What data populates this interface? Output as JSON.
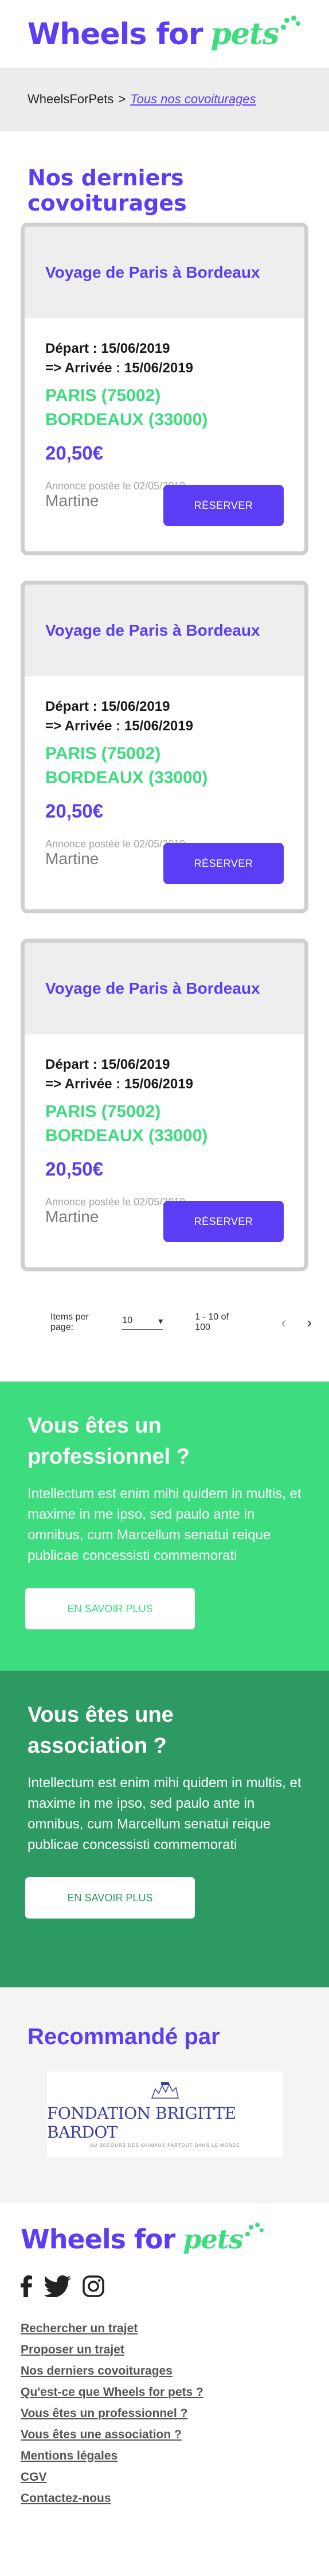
{
  "brand": {
    "name_part1": "Wheels for",
    "name_part2": "pets"
  },
  "breadcrumb": {
    "home": "WheelsForPets",
    "separator": ">",
    "current": "Tous nos covoiturages"
  },
  "page_title": "Nos derniers covoiturages",
  "trips": [
    {
      "title": "Voyage de Paris à Bordeaux",
      "departure": "Départ : 15/06/2019",
      "arrival": "=> Arrivée : 15/06/2019",
      "from": "PARIS (75002)",
      "to": "BORDEAUX (33000)",
      "price": "20,50€",
      "posted": "Annonce postée le 02/05/2019",
      "author": "Martine",
      "button": "RÉSERVER"
    },
    {
      "title": "Voyage de Paris à Bordeaux",
      "departure": "Départ : 15/06/2019",
      "arrival": "=> Arrivée : 15/06/2019",
      "from": "PARIS (75002)",
      "to": "BORDEAUX (33000)",
      "price": "20,50€",
      "posted": "Annonce postée le 02/05/2019",
      "author": "Martine",
      "button": "RÉSERVER"
    },
    {
      "title": "Voyage de Paris à Bordeaux",
      "departure": "Départ : 15/06/2019",
      "arrival": "=> Arrivée : 15/06/2019",
      "from": "PARIS (75002)",
      "to": "BORDEAUX (33000)",
      "price": "20,50€",
      "posted": "Annonce postée le 02/05/2019",
      "author": "Martine",
      "button": "RÉSERVER"
    }
  ],
  "pagination": {
    "items_per_page_label": "Items per page:",
    "items_per_page_value": "10",
    "range": "1 - 10 of 100",
    "prev_icon": "chevron-left",
    "next_icon": "chevron-right"
  },
  "promo_pro": {
    "title": "Vous êtes un professionnel ?",
    "text": "Intellectum est enim mihi quidem in multis, et maxime in me ipso, sed paulo ante in omnibus, cum Marcellum senatui reique publicae concessisti commemorati",
    "button": "EN SAVOIR PLUS"
  },
  "promo_asso": {
    "title": "Vous êtes une association ?",
    "text": "Intellectum est enim mihi quidem in multis, et maxime in me ipso, sed paulo ante in omnibus, cum Marcellum senatui reique publicae concessisti commemorati",
    "button": "EN SAVOIR PLUS"
  },
  "recommended": {
    "title": "Recommandé par",
    "partner_name": "FONDATION BRIGITTE BARDOT",
    "partner_tagline": "AU SECOURS DES ANIMAUX PARTOUT DANS LE MONDE"
  },
  "footer": {
    "social_icons": [
      "facebook-icon",
      "twitter-icon",
      "instagram-icon"
    ],
    "links": [
      "Rechercher un trajet",
      "Proposer un trajet",
      "Nos derniers covoiturages",
      "Qu'est-ce que Wheels for pets ?",
      "Vous êtes un professionnel ?",
      "Vous êtes une association ?",
      "Mentions légales",
      "CGV",
      "Contactez-nous"
    ]
  },
  "colors": {
    "primary": "#5b3df5",
    "green": "#3ddc7e",
    "dark_green": "#2c9a62"
  }
}
